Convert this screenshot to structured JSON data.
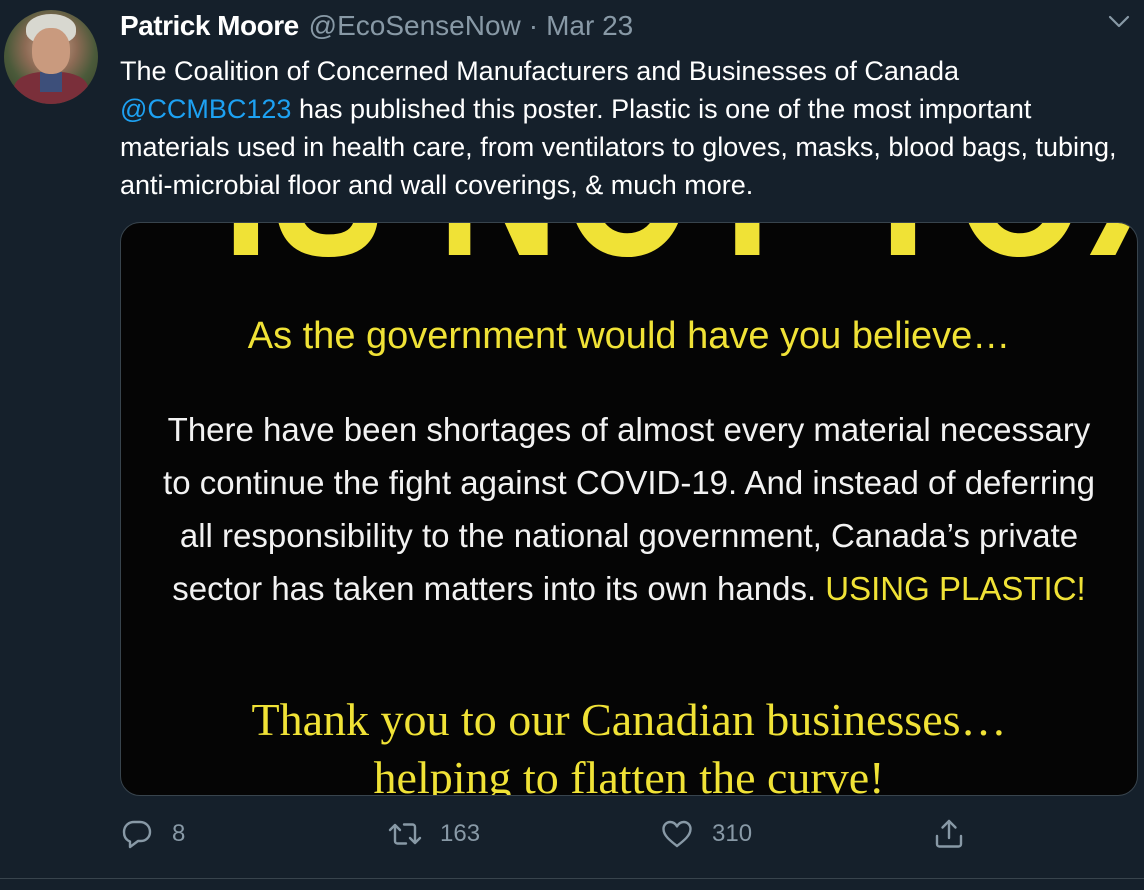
{
  "tweet": {
    "author_name": "Patrick Moore",
    "handle": "@EcoSenseNow",
    "separator": "·",
    "date": "Mar 23",
    "text_before_mention": "The Coalition of Concerned Manufacturers and Businesses of Canada ",
    "mention": "@CCMBC123",
    "text_after_mention": " has published this poster. Plastic is one of the most important materials used in health care, from ventilators to gloves, masks, blood bags, tubing, anti-microbial floor and wall coverings, & much more."
  },
  "poster": {
    "headline": "IS NOT TOXIC",
    "subhead": "As the government would have you believe…",
    "paragraph": "There have been shortages of almost every material necessary to continue the fight against COVID-19. And instead of deferring all responsibility to the national government, Canada’s private sector has taken matters into its own hands. ",
    "paragraph_highlight": "USING PLASTIC!",
    "thanks_line1": "Thank you to our Canadian businesses…",
    "thanks_line2": "helping to flatten the curve!"
  },
  "actions": {
    "reply_count": "8",
    "retweet_count": "163",
    "like_count": "310"
  },
  "icons": {
    "reply": "reply-icon",
    "retweet": "retweet-icon",
    "like": "heart-icon",
    "share": "share-icon",
    "menu": "chevron-down-icon"
  },
  "colors": {
    "background": "#15202b",
    "accent": "#1da1f2",
    "muted": "#8899a6",
    "poster_yellow": "#f0e236"
  }
}
